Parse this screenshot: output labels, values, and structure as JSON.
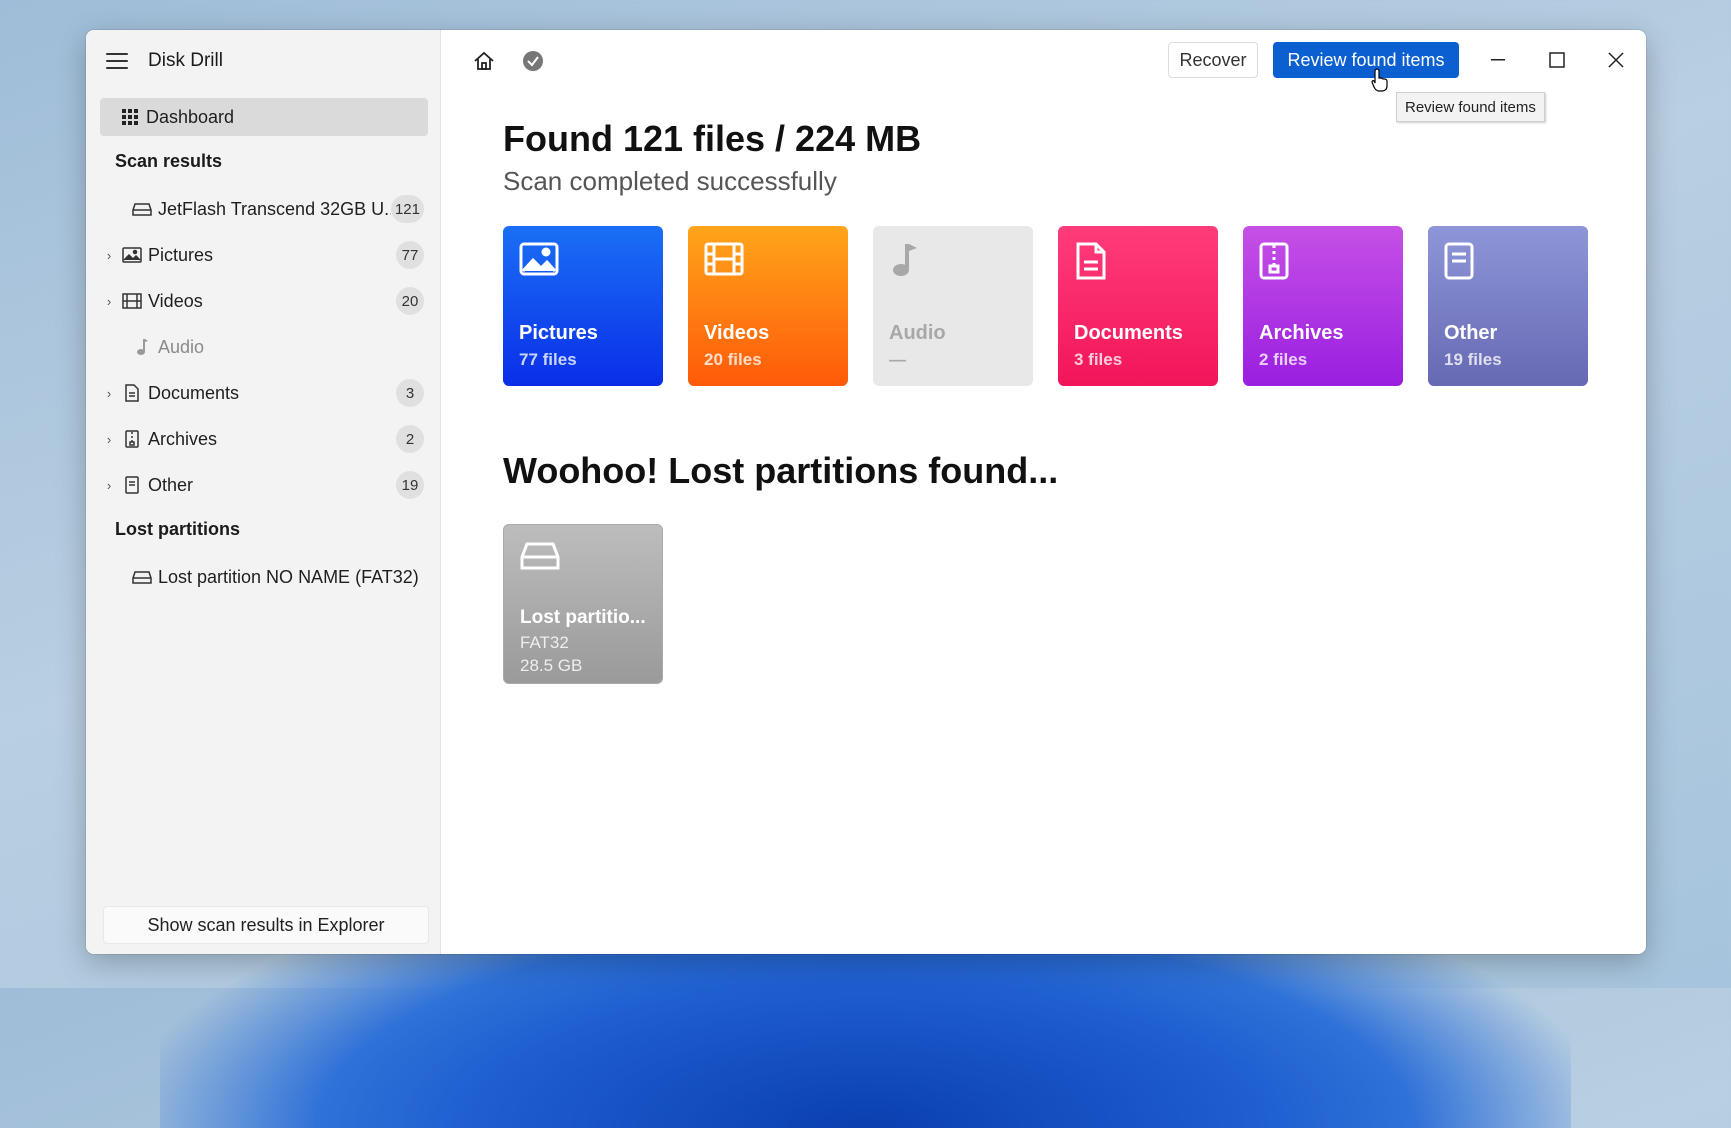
{
  "app": {
    "title": "Disk Drill"
  },
  "sidebar": {
    "dashboard": "Dashboard",
    "scan_results_header": "Scan results",
    "device": {
      "label": "JetFlash Transcend 32GB U...",
      "count": "121"
    },
    "categories": [
      {
        "label": "Pictures",
        "count": "77",
        "icon": "image-icon"
      },
      {
        "label": "Videos",
        "count": "20",
        "icon": "film-icon"
      },
      {
        "label": "Audio",
        "count": "",
        "icon": "music-note-icon"
      },
      {
        "label": "Documents",
        "count": "3",
        "icon": "document-icon"
      },
      {
        "label": "Archives",
        "count": "2",
        "icon": "archive-icon"
      },
      {
        "label": "Other",
        "count": "19",
        "icon": "file-icon"
      }
    ],
    "lost_partitions_header": "Lost partitions",
    "lost_partition": "Lost partition NO NAME (FAT32)",
    "explorer_button": "Show scan results in Explorer"
  },
  "toolbar": {
    "recover_label": "Recover",
    "review_label": "Review found items",
    "tooltip": "Review found items"
  },
  "main": {
    "title": "Found 121 files / 224 MB",
    "subtitle": "Scan completed successfully",
    "tiles": [
      {
        "name": "Pictures",
        "count": "77 files"
      },
      {
        "name": "Videos",
        "count": "20 files"
      },
      {
        "name": "Audio",
        "count": "—"
      },
      {
        "name": "Documents",
        "count": "3 files"
      },
      {
        "name": "Archives",
        "count": "2 files"
      },
      {
        "name": "Other",
        "count": "19 files"
      }
    ],
    "partitions_title": "Woohoo! Lost partitions found...",
    "partition_tile": {
      "name": "Lost partitio...",
      "fs": "FAT32",
      "size": "28.5 GB"
    }
  },
  "colors": {
    "accent": "#0b5fd0",
    "pictures": "#0a2ee8",
    "videos": "#ff5a09",
    "audio": "#e8e8e8",
    "documents": "#f2155a",
    "archives": "#9a1ee0",
    "other": "#6669b3"
  }
}
